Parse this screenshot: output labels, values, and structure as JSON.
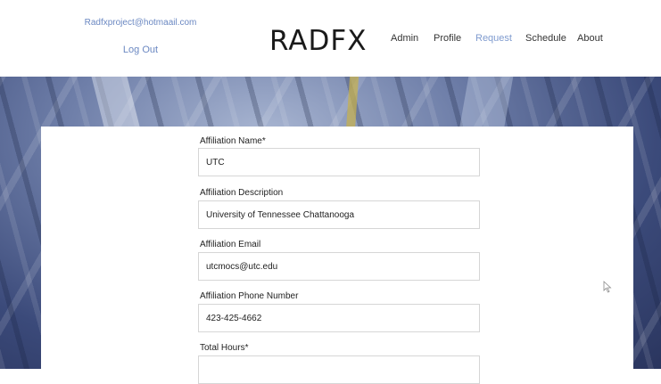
{
  "header": {
    "account_email": "Radfxproject@hotmaail.com",
    "logout_label": "Log Out",
    "brand": "RADFX",
    "nav": {
      "admin": "Admin",
      "profile": "Profile",
      "request": "Request",
      "schedule": "Schedule",
      "about": "About"
    },
    "active_nav": "Request",
    "active_color": "#7f9bcf"
  },
  "form": {
    "affiliation_name": {
      "label": "Affiliation Name*",
      "value": "UTC"
    },
    "affiliation_description": {
      "label": "Affiliation Description",
      "value": "University of Tennessee Chattanooga"
    },
    "affiliation_email": {
      "label": "Affiliation Email",
      "value": "utcmocs@utc.edu"
    },
    "affiliation_phone": {
      "label": "Affiliation Phone Number",
      "value": "423-425-4662"
    },
    "total_hours": {
      "label": "Total Hours*",
      "value": ""
    }
  },
  "icons": {
    "cursor": "mouse-pointer-icon"
  }
}
